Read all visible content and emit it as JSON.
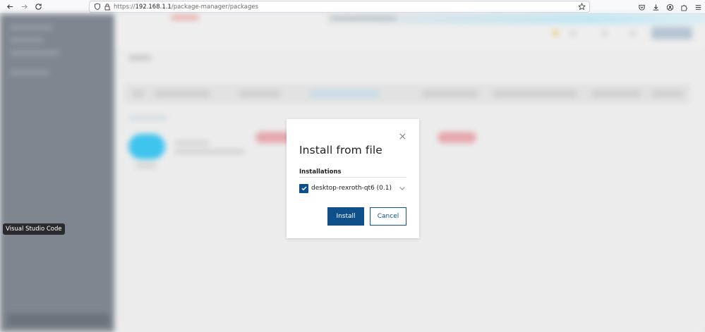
{
  "browser": {
    "url_prefix": "https://",
    "url_host": "192.168.1.1",
    "url_path": "/package-manager/packages",
    "icons": {
      "back": "arrow-left-icon",
      "forward": "arrow-right-icon",
      "reload": "reload-icon",
      "shield": "shield-icon",
      "lock": "lock-icon",
      "bookmark": "star-icon",
      "pocket": "pocket-icon",
      "downloads": "download-icon",
      "account": "account-icon",
      "extensions": "puzzle-icon",
      "menu": "hamburger-menu-icon"
    }
  },
  "tooltip": {
    "text": "Visual Studio Code"
  },
  "modal": {
    "title": "Install from file",
    "section_label": "Installations",
    "items": [
      {
        "label": "desktop-rexroth-qt6 (0.1)",
        "checked": true
      }
    ],
    "install_label": "Install",
    "cancel_label": "Cancel"
  },
  "colors": {
    "primary": "#0f4f8a",
    "checkbox": "#0d4f8b",
    "overlay_bg": "#ebebeb",
    "sidebar": "#7f8690"
  }
}
